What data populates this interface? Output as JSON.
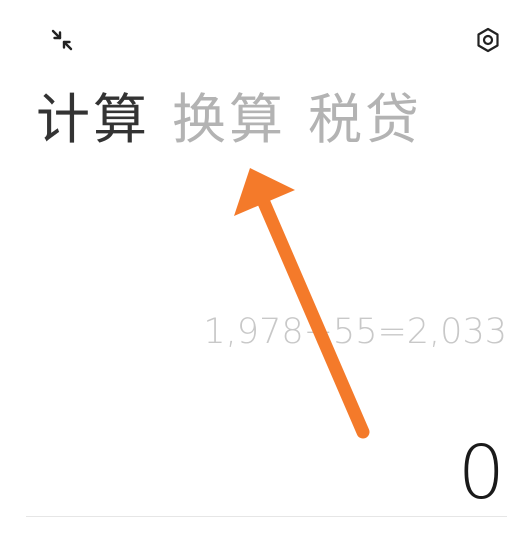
{
  "header": {
    "collapse_icon": "collapse-arrows-icon",
    "settings_icon": "hexagon-settings-icon"
  },
  "tabs": [
    {
      "label": "计算",
      "active": true
    },
    {
      "label": "换算",
      "active": false
    },
    {
      "label": "税贷",
      "active": false
    }
  ],
  "calculator": {
    "history": "1,978+55=2,033",
    "display": "0"
  },
  "annotation": {
    "arrow_color": "#f47a2a"
  },
  "colors": {
    "active_tab": "#333333",
    "inactive_tab": "#b3b3b3",
    "history_text": "#c8c8c8",
    "display_text": "#1a1a1a"
  }
}
